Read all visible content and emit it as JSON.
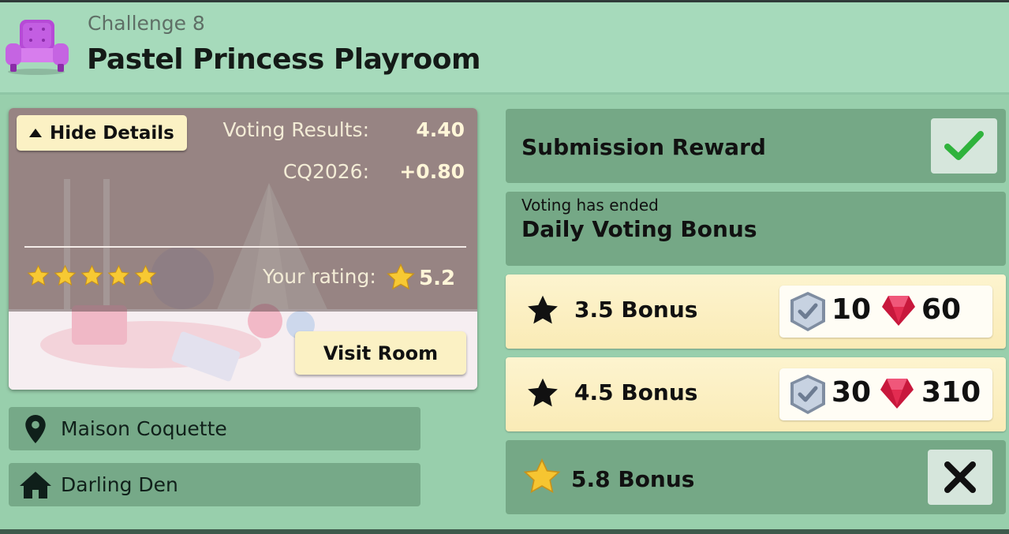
{
  "header": {
    "challenge_label": "Challenge 8",
    "room_title": "Pastel Princess Playroom",
    "icon": "purple-armchair-icon"
  },
  "room_card": {
    "hide_details_label": "Hide Details",
    "voting_results_label": "Voting Results:",
    "voting_results_value": "4.40",
    "cq_label": "CQ2026:",
    "cq_value": "+0.80",
    "community_stars": 5,
    "your_rating_label": "Your rating:",
    "your_rating_value": "5.2",
    "visit_room_label": "Visit Room"
  },
  "info_rows": [
    {
      "icon": "location-pin-icon",
      "label": "Maison Coquette"
    },
    {
      "icon": "home-icon",
      "label": "Darling Den"
    }
  ],
  "rewards": {
    "submission": {
      "label": "Submission Reward",
      "status": "claimed",
      "status_icon": "checkmark-icon"
    },
    "daily": {
      "status_text": "Voting has ended",
      "label": "Daily Voting Bonus"
    },
    "bonuses": [
      {
        "label": "3.5 Bonus",
        "star_color": "#111111",
        "coins": "10",
        "gems": "60",
        "achieved": true
      },
      {
        "label": "4.5 Bonus",
        "star_color": "#111111",
        "coins": "30",
        "gems": "310",
        "achieved": true
      },
      {
        "label": "5.8 Bonus",
        "star_color": "#f6c531",
        "achieved": false,
        "status_icon": "x-mark-icon"
      }
    ]
  },
  "colors": {
    "background": "#a3d7b6",
    "panel_green": "#75a886",
    "panel_cream": "#fbf0c2",
    "check_green": "#2fb33c",
    "gem_red": "#e0284c"
  }
}
